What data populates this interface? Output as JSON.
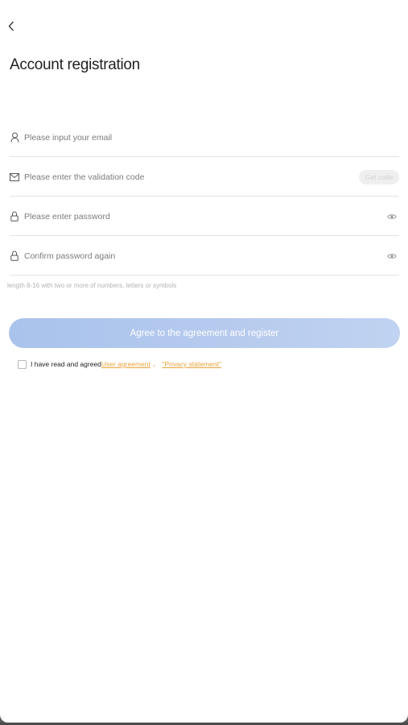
{
  "header": {
    "back_icon": "chevron-left-icon",
    "title": "Account registration"
  },
  "form": {
    "email": {
      "icon": "user-icon",
      "placeholder": "Please input your email",
      "value": ""
    },
    "code": {
      "icon": "mail-icon",
      "placeholder": "Please enter the validation code",
      "value": "",
      "get_code_label": "Get code"
    },
    "password": {
      "icon": "lock-icon",
      "placeholder": "Please enter password",
      "value": "",
      "toggle_icon": "eye-icon"
    },
    "confirm": {
      "icon": "lock-icon",
      "placeholder": "Confirm password again",
      "value": "",
      "toggle_icon": "eye-icon"
    },
    "hint": "length 8-16 with two or more of numbers, letters or symbols"
  },
  "actions": {
    "register_label": "Agree to the agreement and register"
  },
  "agreement": {
    "prefix": "I have read and agreed",
    "user_agreement": "User agreement",
    "separator": "、",
    "privacy_statement": "\"Privacy statement\"",
    "checked": false
  },
  "colors": {
    "primary_button": "#b3c9ee",
    "link": "#e8a33a",
    "divider": "#e4e4e4"
  }
}
